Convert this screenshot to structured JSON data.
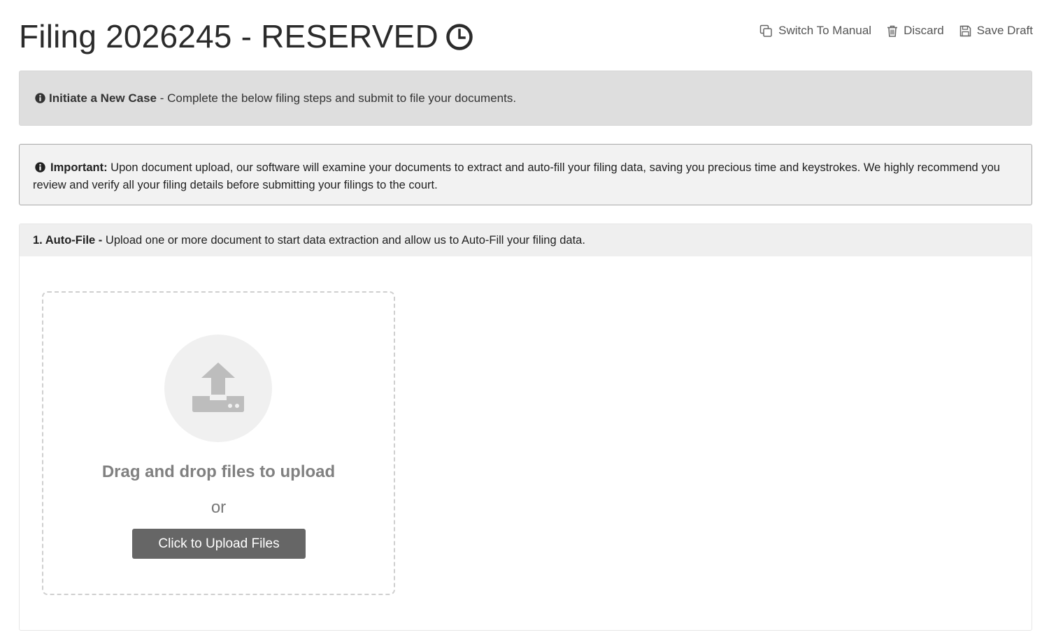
{
  "header": {
    "title": "Filing 2026245 - RESERVED",
    "status_icon": "clock-icon"
  },
  "actions": {
    "switch_manual_label": "Switch To Manual",
    "switch_manual_icon": "copy-icon",
    "discard_label": "Discard",
    "discard_icon": "trash-icon",
    "save_draft_label": "Save Draft",
    "save_draft_icon": "floppy-disk-icon"
  },
  "info_banner": {
    "icon": "info-circle-icon",
    "title": "Initiate a New Case",
    "text": " - Complete the below filing steps and submit to file your documents."
  },
  "important_notice": {
    "icon": "info-circle-icon",
    "title": "Important:",
    "text": " Upon document upload, our software will examine your documents to extract and auto-fill your filing data, saving you precious time and keystrokes. We highly recommend you review and verify all your filing details before submitting your filings to the court."
  },
  "step1": {
    "title": "1. Auto-File -",
    "text": " Upload one or more document to start data extraction and allow us to Auto-Fill your filing data.",
    "dropzone": {
      "icon": "upload-tray-icon",
      "drag_text": "Drag and drop files to upload",
      "or_text": "or",
      "button_label": "Click to Upload Files"
    }
  },
  "colors": {
    "banner_bg": "#dedede",
    "important_bg": "#f2f2f2",
    "step_header_bg": "#efefef",
    "button_bg": "#666666",
    "dropzone_border": "#cfcfcf"
  }
}
